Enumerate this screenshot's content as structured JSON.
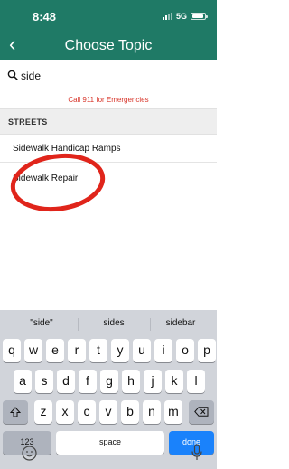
{
  "status": {
    "time": "8:48",
    "network": "5G"
  },
  "header": {
    "title": "Choose Topic",
    "back_icon": "chevron-left-icon"
  },
  "search": {
    "value": "side"
  },
  "notice": {
    "text": "Call 911 for Emergencies"
  },
  "section": {
    "title": "STREETS"
  },
  "results": [
    {
      "label": "Sidewalk Handicap Ramps"
    },
    {
      "label": "Sidewalk Repair"
    }
  ],
  "keyboard": {
    "suggestions": [
      "\"side\"",
      "sides",
      "sidebar"
    ],
    "row1": [
      "q",
      "w",
      "e",
      "r",
      "t",
      "y",
      "u",
      "i",
      "o",
      "p"
    ],
    "row2": [
      "a",
      "s",
      "d",
      "f",
      "g",
      "h",
      "j",
      "k",
      "l"
    ],
    "row3": [
      "z",
      "x",
      "c",
      "v",
      "b",
      "n",
      "m"
    ],
    "numbers_label": "123",
    "space_label": "space",
    "done_label": "done"
  },
  "colors": {
    "header": "#1f7a66",
    "emergency_text": "#d8352a",
    "done_key": "#1a82fb",
    "annotation": "#e0251b"
  }
}
